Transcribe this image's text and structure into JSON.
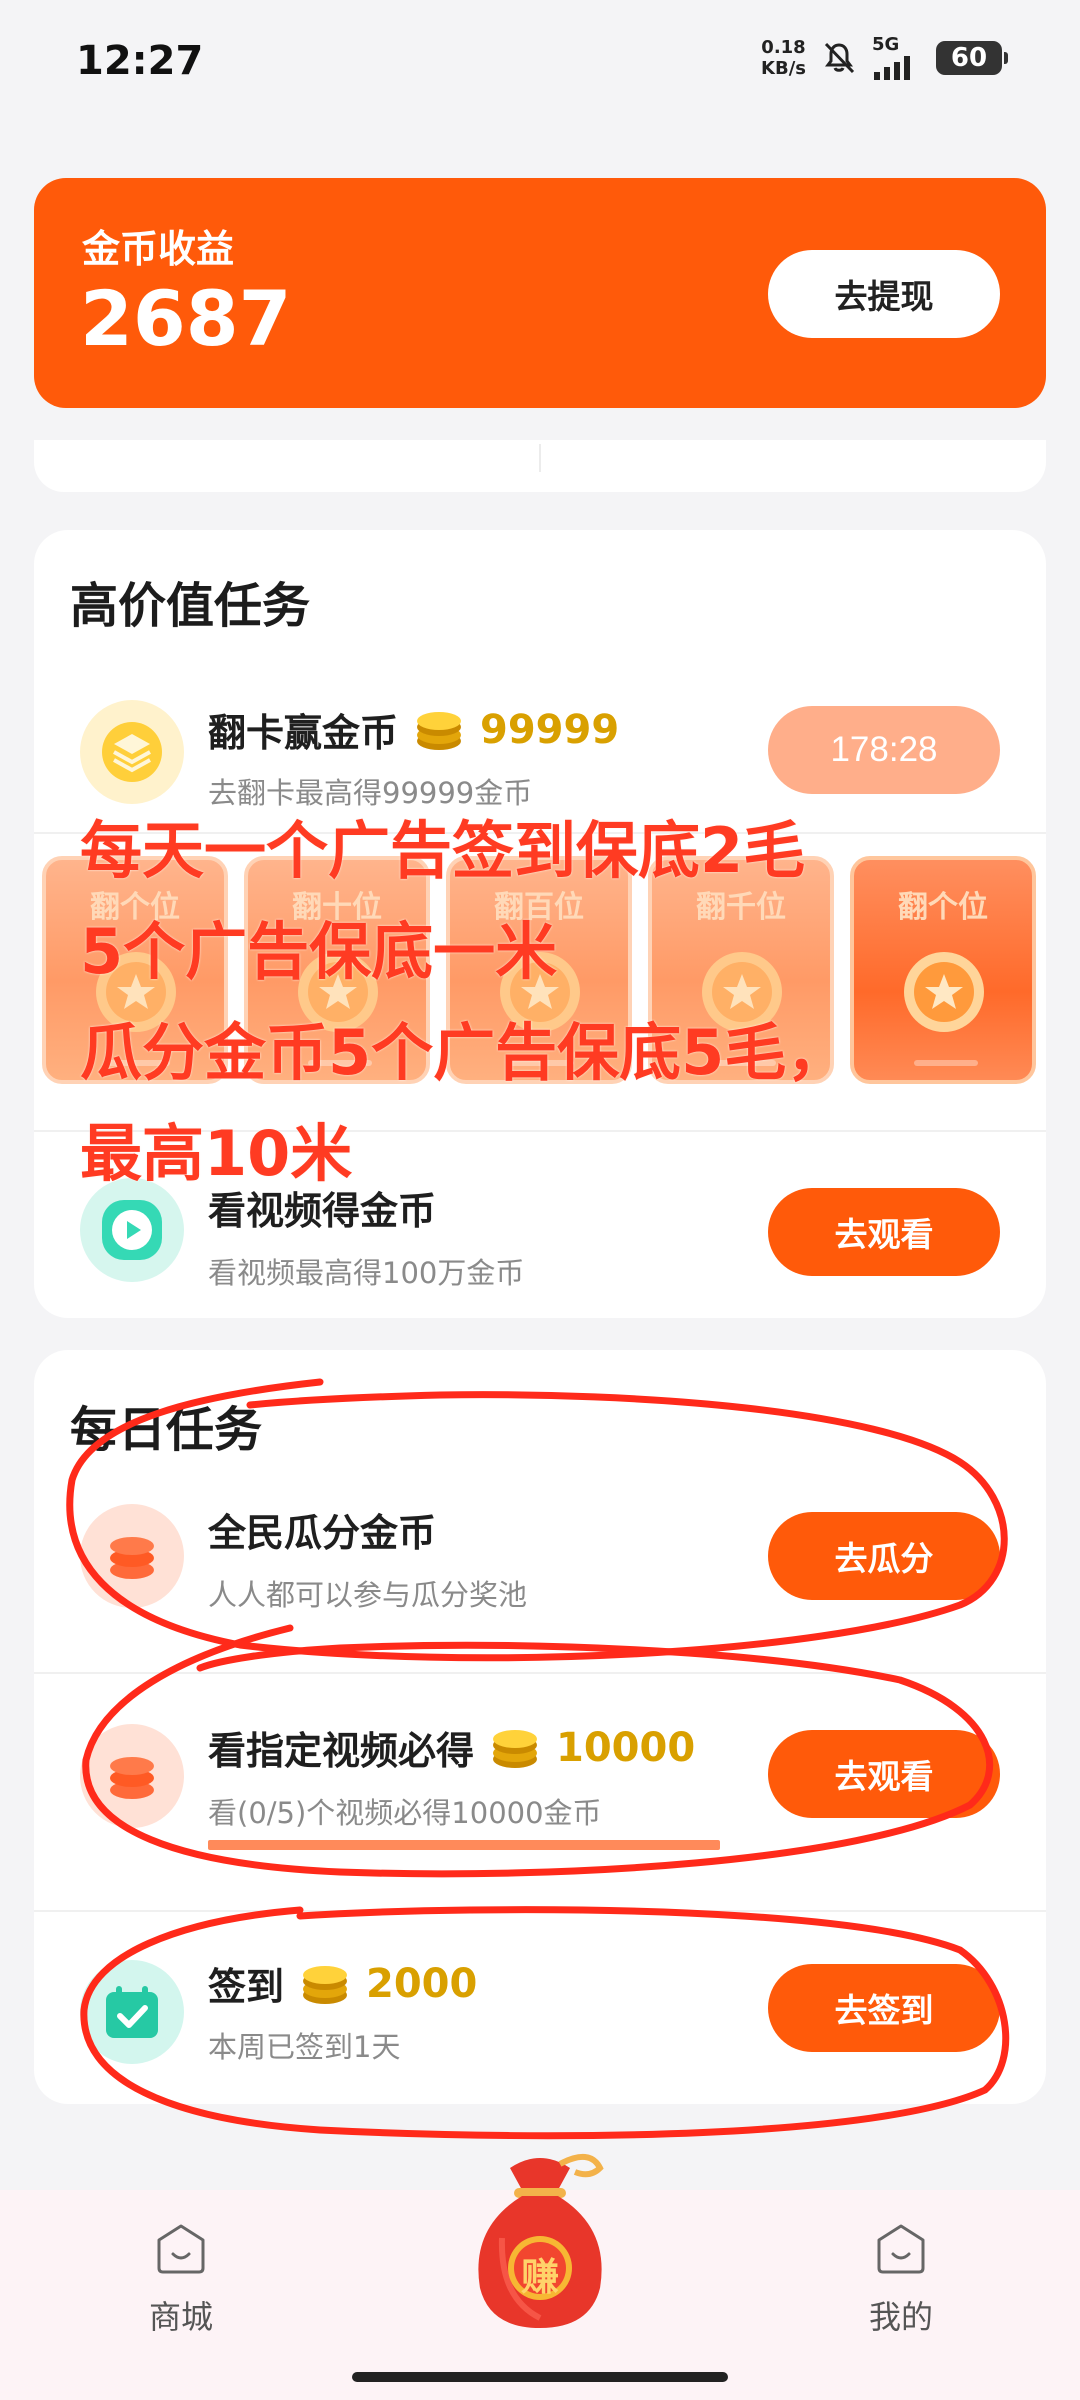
{
  "status_bar": {
    "time": "12:27",
    "net_speed_value": "0.18",
    "net_speed_unit": "KB/s",
    "network": "5G",
    "battery": "60",
    "icons": [
      "mute-bell-icon",
      "signal-icon"
    ]
  },
  "coin_card": {
    "label": "金币收益",
    "value": "2687",
    "withdraw_button": "去提现"
  },
  "high_value": {
    "title": "高价值任务",
    "tasks": [
      {
        "title": "翻卡赢金币",
        "reward": "99999",
        "subtitle": "去翻卡最高得99999金币",
        "button": "178:28",
        "icon": "layers-icon"
      },
      {
        "title": "看视频得金币",
        "subtitle": "看视频最高得100万金币",
        "button": "去观看",
        "icon": "play-icon"
      }
    ],
    "flip_cards": [
      {
        "label": "翻个位"
      },
      {
        "label": "翻十位"
      },
      {
        "label": "翻百位"
      },
      {
        "label": "翻千位"
      },
      {
        "label": "翻个位"
      }
    ]
  },
  "annotation": {
    "lines": [
      "每天一个广告签到保底2毛",
      "5个广告保底一米",
      "瓜分金币5个广告保底5毛，",
      "最高10米"
    ],
    "color": "#ff3b22"
  },
  "daily": {
    "title": "每日任务",
    "tasks": [
      {
        "title": "全民瓜分金币",
        "subtitle": "人人都可以参与瓜分奖池",
        "button": "去瓜分",
        "icon": "coin-stack-icon"
      },
      {
        "title": "看指定视频必得",
        "reward": "10000",
        "subtitle": "看(0/5)个视频必得10000金币",
        "button": "去观看",
        "icon": "coin-stack-icon"
      },
      {
        "title": "签到",
        "reward": "2000",
        "subtitle": "本周已签到1天",
        "button": "去签到",
        "icon": "calendar-check-icon"
      }
    ]
  },
  "bottom_nav": {
    "items": [
      {
        "label": "商城",
        "icon": "mall-icon"
      },
      {
        "label": "赚",
        "icon": "money-bag-icon"
      },
      {
        "label": "我的",
        "icon": "profile-icon"
      }
    ]
  },
  "colors": {
    "accent": "#ff5a0a",
    "gold": "#d9a000",
    "annotation_red": "#ff3b22"
  }
}
